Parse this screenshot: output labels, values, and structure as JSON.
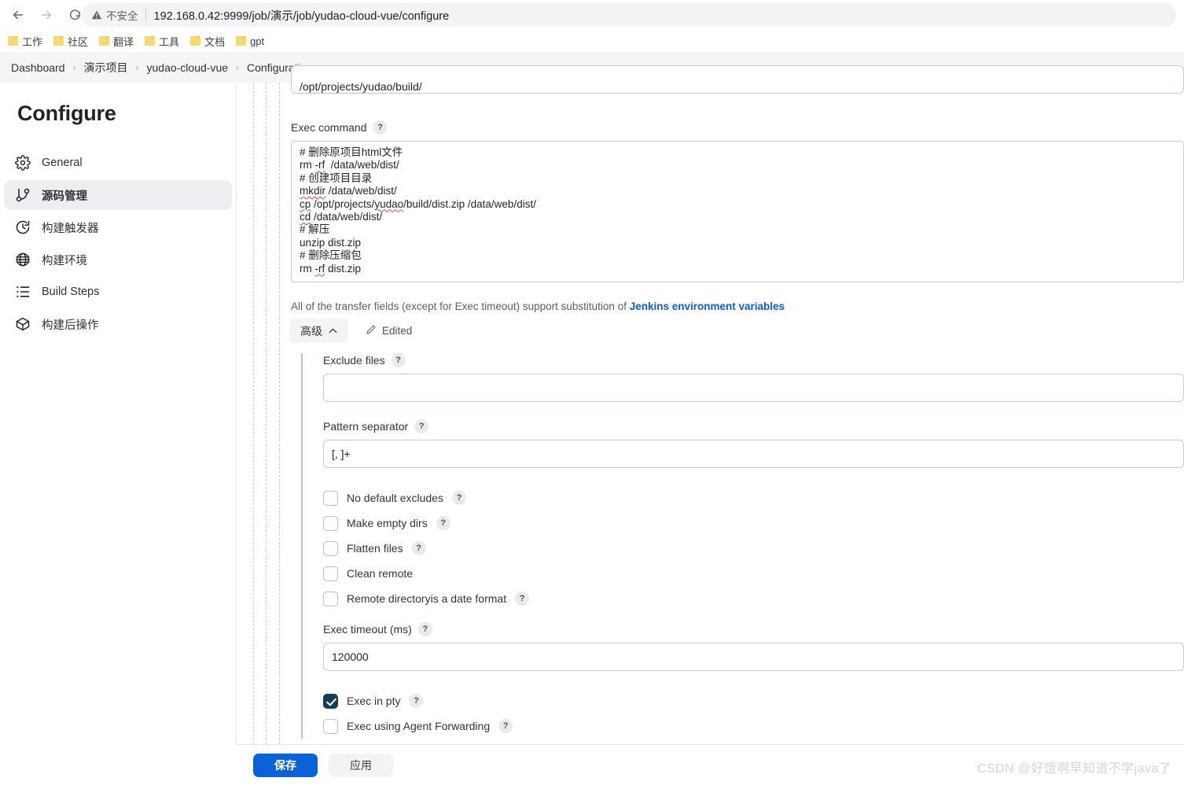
{
  "browser": {
    "back_icon": "arrow-left-icon",
    "forward_icon": "arrow-right-icon",
    "reload_icon": "reload-icon",
    "security_label": "不安全",
    "security_icon": "warning-triangle-icon",
    "url": "192.168.0.42:9999/job/演示/job/yudao-cloud-vue/configure",
    "bookmarks": [
      {
        "label": "工作",
        "icon": "folder-icon"
      },
      {
        "label": "社区",
        "icon": "folder-icon"
      },
      {
        "label": "翻译",
        "icon": "folder-icon"
      },
      {
        "label": "工具",
        "icon": "folder-icon"
      },
      {
        "label": "文档",
        "icon": "folder-icon"
      },
      {
        "label": "gpt",
        "icon": "folder-icon"
      }
    ]
  },
  "breadcrumb": {
    "separator": "›",
    "items": [
      "Dashboard",
      "演示项目",
      "yudao-cloud-vue",
      "Configuration"
    ]
  },
  "sidebar": {
    "title": "Configure",
    "items": [
      {
        "label": "General",
        "icon": "gear-icon",
        "active": false
      },
      {
        "label": "源码管理",
        "icon": "git-branch-icon",
        "active": true
      },
      {
        "label": "构建触发器",
        "icon": "clock-icon",
        "active": false
      },
      {
        "label": "构建环境",
        "icon": "globe-icon",
        "active": false
      },
      {
        "label": "Build Steps",
        "icon": "list-steps-icon",
        "active": false
      },
      {
        "label": "构建后操作",
        "icon": "package-icon",
        "active": false
      }
    ]
  },
  "form": {
    "remote_directory": {
      "value": "/opt/projects/yudao/build/"
    },
    "exec_command": {
      "label": "Exec command",
      "help": "?",
      "value": "# 删除原项目html文件\nrm -rf  /data/web/dist/\n# 创建项目目录\nmkdir /data/web/dist/\ncp /opt/projects/yudao/build/dist.zip /data/web/dist/\ncd /data/web/dist/\n# 解压\nunzip dist.zip\n# 删除压缩包\nrm -rf dist.zip",
      "lines": [
        "# 删除原项目html文件",
        "rm -rf  /data/web/dist/",
        "# 创建项目目录",
        "mkdir /data/web/dist/",
        "cp /opt/projects/yudao/build/dist.zip /data/web/dist/",
        "cd /data/web/dist/",
        "# 解压",
        "unzip dist.zip",
        "# 删除压缩包",
        "rm -rf dist.zip"
      ]
    },
    "substitution_note": {
      "prefix": "All of the transfer fields (except for Exec timeout) support substitution of ",
      "link": "Jenkins environment variables"
    },
    "advanced_toggle": {
      "label": "高级",
      "chevron": "⌃"
    },
    "edited_badge": {
      "label": "Edited",
      "icon": "pencil-icon"
    },
    "advanced": {
      "exclude_files": {
        "label": "Exclude files",
        "help": "?",
        "value": "",
        "placeholder": ""
      },
      "pattern_separator": {
        "label": "Pattern separator",
        "help": "?",
        "value": "[, ]+",
        "placeholder": ""
      },
      "checkboxes": [
        {
          "label": "No default excludes",
          "help": "?",
          "checked": false
        },
        {
          "label": "Make empty dirs",
          "help": "?",
          "checked": false
        },
        {
          "label": "Flatten files",
          "help": "?",
          "checked": false
        },
        {
          "label": "Clean remote",
          "help": "",
          "checked": false
        },
        {
          "label": "Remote directoryis a date format",
          "help": "?",
          "checked": false
        }
      ],
      "exec_timeout": {
        "label": "Exec timeout (ms)",
        "help": "?",
        "value": "120000"
      },
      "bottom_checkboxes": [
        {
          "label": "Exec in pty",
          "help": "?",
          "checked": true
        },
        {
          "label": "Exec using Agent Forwarding",
          "help": "?",
          "checked": false
        }
      ]
    }
  },
  "footer": {
    "save_label": "保存",
    "apply_label": "应用"
  },
  "watermark": "CSDN @好饿啊早知道不学java了",
  "colors": {
    "accent": "#0b62d6",
    "link": "#0b5ed7",
    "checkbox_checked": "#123e5c",
    "sidebar_active": "#eceef2",
    "breadcrumb_bg": "#f4f5f7"
  }
}
